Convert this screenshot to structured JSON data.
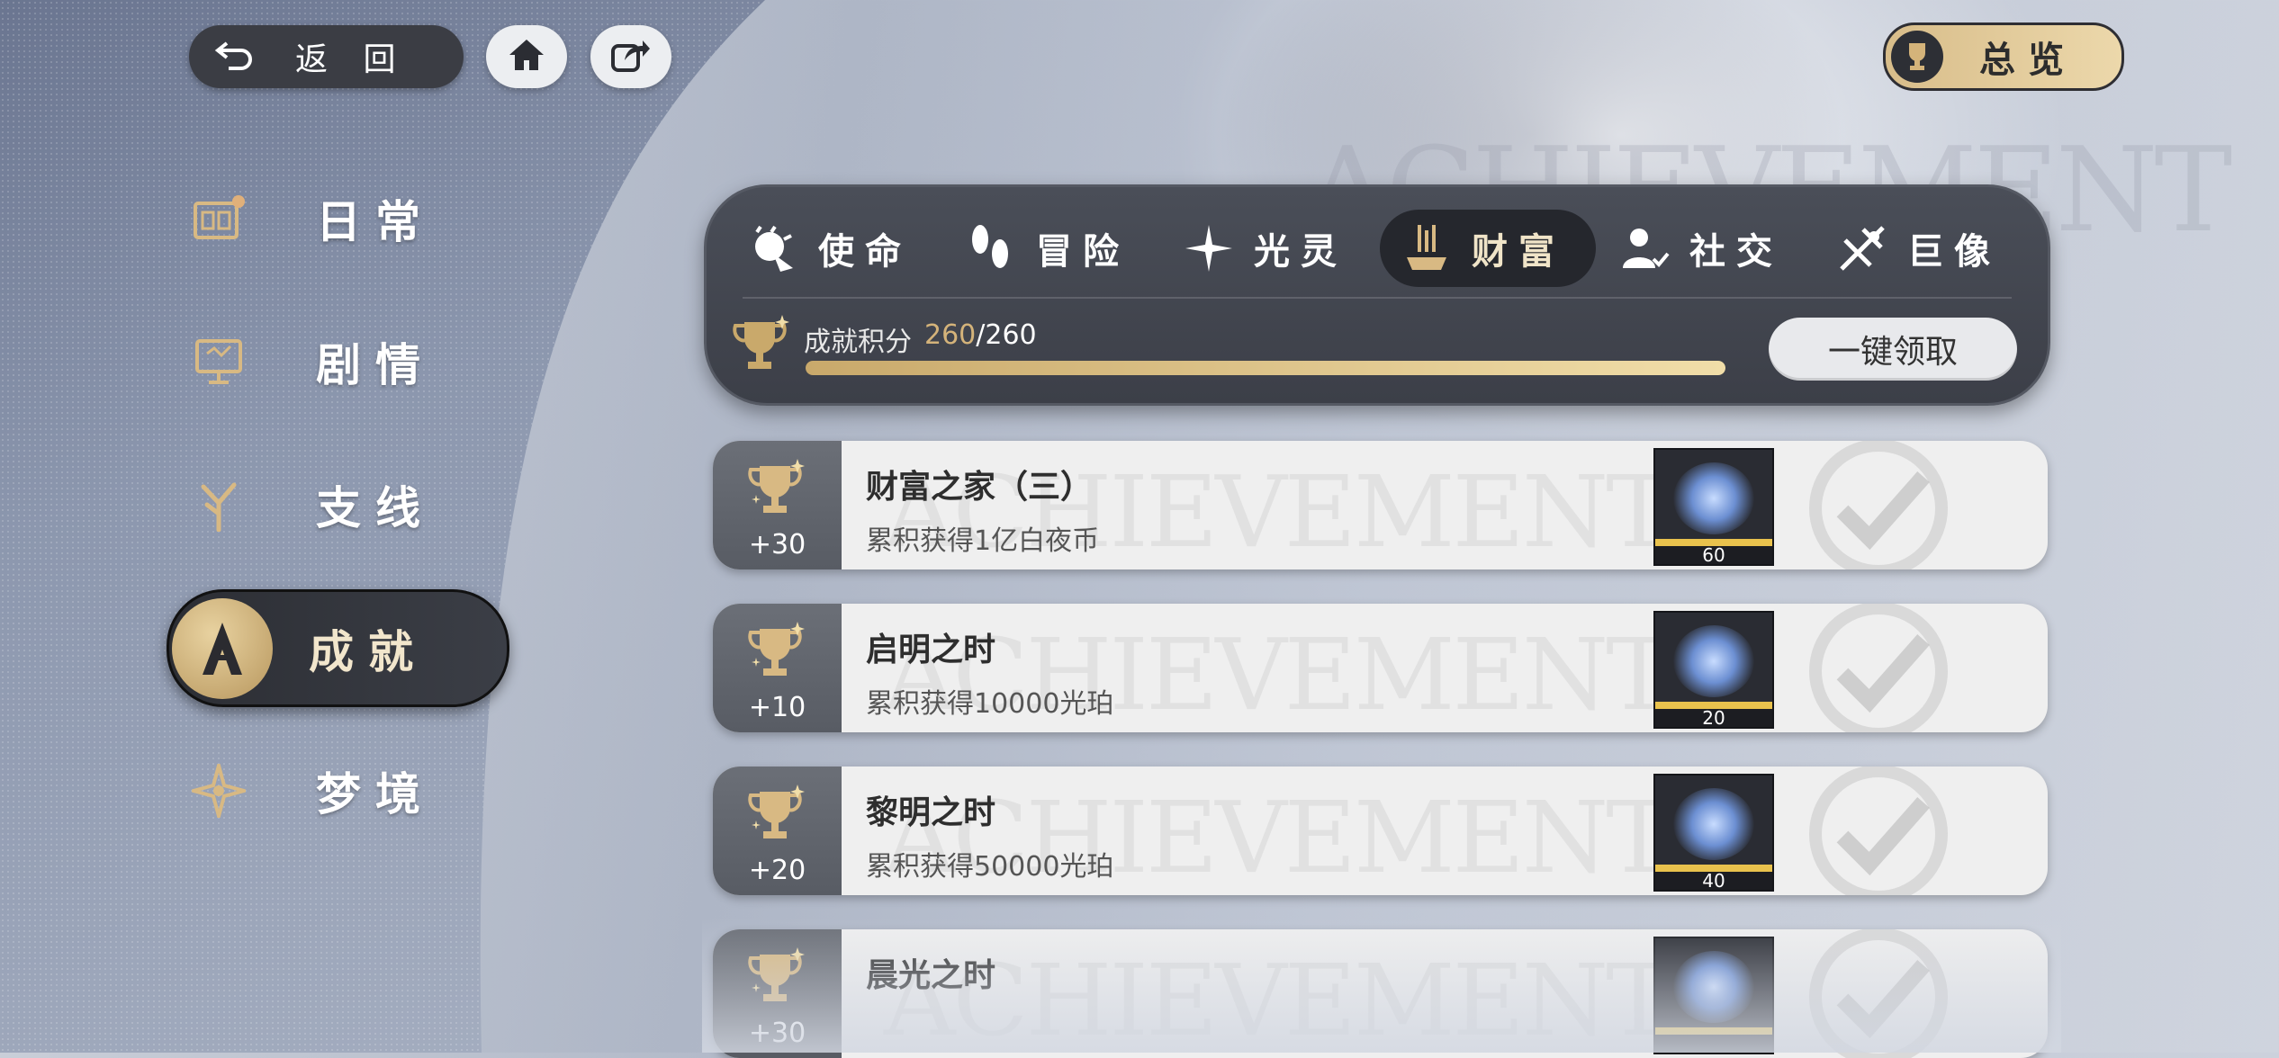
{
  "topbar": {
    "back_label": "返 回",
    "overview_label": "总览"
  },
  "watermark_text": "ACHIEVEMENT",
  "nav": {
    "items": [
      {
        "label": "日常",
        "icon": "calendar-icon"
      },
      {
        "label": "剧情",
        "icon": "monitor-icon"
      },
      {
        "label": "支线",
        "icon": "branch-icon"
      },
      {
        "label": "成就",
        "icon": "achievement-icon",
        "active": true
      },
      {
        "label": "梦境",
        "icon": "star-icon"
      }
    ]
  },
  "tabs": [
    {
      "label": "使命",
      "icon": "mission-icon"
    },
    {
      "label": "冒险",
      "icon": "footprint-icon"
    },
    {
      "label": "光灵",
      "icon": "sparkle-icon"
    },
    {
      "label": "财富",
      "icon": "wealth-icon",
      "active": true
    },
    {
      "label": "社交",
      "icon": "social-icon"
    },
    {
      "label": "巨像",
      "icon": "colossus-icon"
    }
  ],
  "score": {
    "label": "成就积分",
    "current": "260",
    "total": "/260",
    "progress": 1.0
  },
  "claim_label": "一键领取",
  "card_watermark": "ACHIEVEMENTS",
  "achievements": [
    {
      "points": "+30",
      "title": "财富之家（三）",
      "desc": "累积获得1亿白夜币",
      "reward_count": "60",
      "completed": true
    },
    {
      "points": "+10",
      "title": "启明之时",
      "desc": "累积获得10000光珀",
      "reward_count": "20",
      "completed": true
    },
    {
      "points": "+20",
      "title": "黎明之时",
      "desc": "累积获得50000光珀",
      "reward_count": "40",
      "completed": true
    },
    {
      "points": "+30",
      "title": "晨光之时",
      "desc": "",
      "reward_count": "",
      "completed": true
    }
  ],
  "colors": {
    "gold": "#d4b37a",
    "panel": "#3c3f48",
    "card": "#efefef"
  }
}
